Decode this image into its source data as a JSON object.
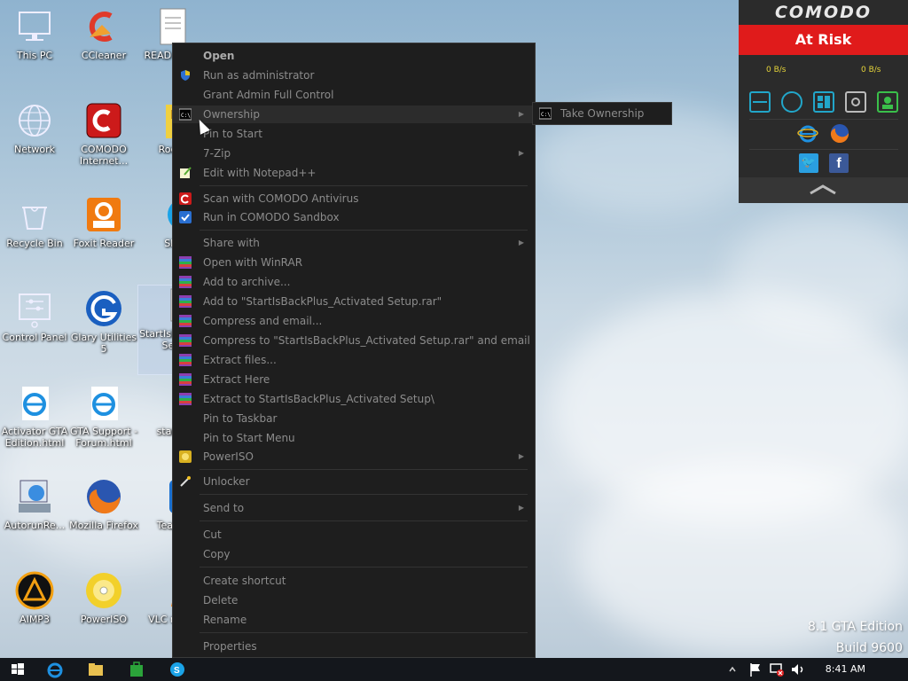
{
  "desktop": {
    "icons": [
      {
        "label": "This PC"
      },
      {
        "label": "CCleaner"
      },
      {
        "label": "READ FIRST"
      },
      {
        "label": "Network"
      },
      {
        "label": "COMODO Internet..."
      },
      {
        "label": "Rocke"
      },
      {
        "label": "Recycle Bin"
      },
      {
        "label": "Foxit Reader"
      },
      {
        "label": "Sky"
      },
      {
        "label": "Control Panel"
      },
      {
        "label": "Glary Utilities 5"
      },
      {
        "label": "StartIsB s_Act Setu"
      },
      {
        "label": "Activator GTA Edition.html"
      },
      {
        "label": "GTA Support - Forum.html"
      },
      {
        "label": "startor"
      },
      {
        "label": "AutorunRe..."
      },
      {
        "label": "Mozilla Firefox"
      },
      {
        "label": "TeamV"
      },
      {
        "label": "AIMP3"
      },
      {
        "label": "PowerISO"
      },
      {
        "label": "VLC m pla"
      }
    ]
  },
  "context_menu": {
    "items": [
      {
        "label": "Open"
      },
      {
        "label": "Run as administrator"
      },
      {
        "label": "Grant Admin Full Control"
      },
      {
        "label": "Ownership"
      },
      {
        "label": "Pin to Start"
      },
      {
        "label": "7-Zip"
      },
      {
        "label": "Edit with Notepad++"
      },
      {
        "label": "Scan with COMODO Antivirus"
      },
      {
        "label": "Run in COMODO Sandbox"
      },
      {
        "label": "Share with"
      },
      {
        "label": "Open with WinRAR"
      },
      {
        "label": "Add to archive..."
      },
      {
        "label": "Add to \"StartIsBackPlus_Activated Setup.rar\""
      },
      {
        "label": "Compress and email..."
      },
      {
        "label": "Compress to \"StartIsBackPlus_Activated Setup.rar\" and email"
      },
      {
        "label": "Extract files..."
      },
      {
        "label": "Extract Here"
      },
      {
        "label": "Extract to StartIsBackPlus_Activated Setup\\"
      },
      {
        "label": "Pin to Taskbar"
      },
      {
        "label": "Pin to Start Menu"
      },
      {
        "label": "PowerISO"
      },
      {
        "label": "Unlocker"
      },
      {
        "label": "Send to"
      },
      {
        "label": "Cut"
      },
      {
        "label": "Copy"
      },
      {
        "label": "Create shortcut"
      },
      {
        "label": "Delete"
      },
      {
        "label": "Rename"
      },
      {
        "label": "Properties"
      }
    ],
    "submenu": {
      "label": "Take Ownership"
    }
  },
  "comodo": {
    "logo": "COMODO",
    "status": "At Risk",
    "rate_in": "0 B/s",
    "rate_out": "0 B/s",
    "colors": {
      "status_bg": "#e01b1b",
      "accent": "#22a6c9"
    }
  },
  "watermark": {
    "edition": "8.1 GTA Edition",
    "build": "Build 9600"
  },
  "taskbar": {
    "clock": "8:41 AM"
  }
}
